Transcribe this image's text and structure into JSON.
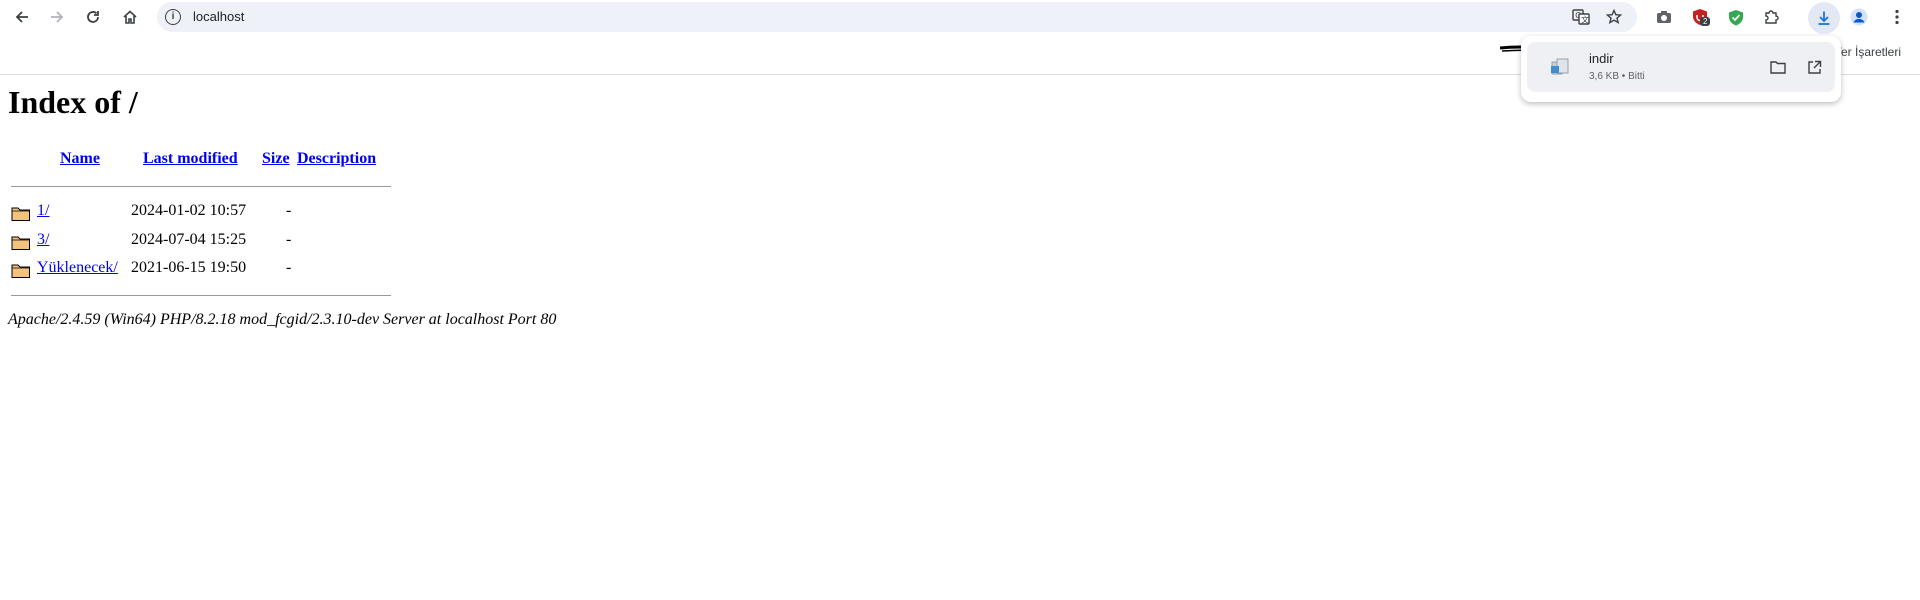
{
  "browser": {
    "url": "localhost",
    "bookmarks_label": "Yer İşaretleri",
    "bookmarks_label_visible": "Yer İşaretleri",
    "extension_badge_count": "2"
  },
  "page": {
    "heading": "Index of /",
    "columns": {
      "name": "Name",
      "last_modified": "Last modified",
      "size": "Size",
      "description": "Description"
    },
    "rows": [
      {
        "name": "1/",
        "modified": "2024-01-02 10:57",
        "size": "-"
      },
      {
        "name": "3/",
        "modified": "2024-07-04 15:25",
        "size": "-"
      },
      {
        "name": "Yüklenecek/",
        "modified": "2021-06-15 19:50",
        "size": "-"
      }
    ],
    "footer": "Apache/2.4.59 (Win64) PHP/8.2.18 mod_fcgid/2.3.10-dev Server at localhost Port 80"
  },
  "download": {
    "filename": "indir",
    "status": "3,6 KB • Bitti"
  },
  "colors": {
    "link": "#0000ee",
    "omnibox_bg": "#eef1f8",
    "extension_shield_red": "#c5221f",
    "extension_shield_green": "#34a853",
    "download_active": "#1a73e8"
  }
}
